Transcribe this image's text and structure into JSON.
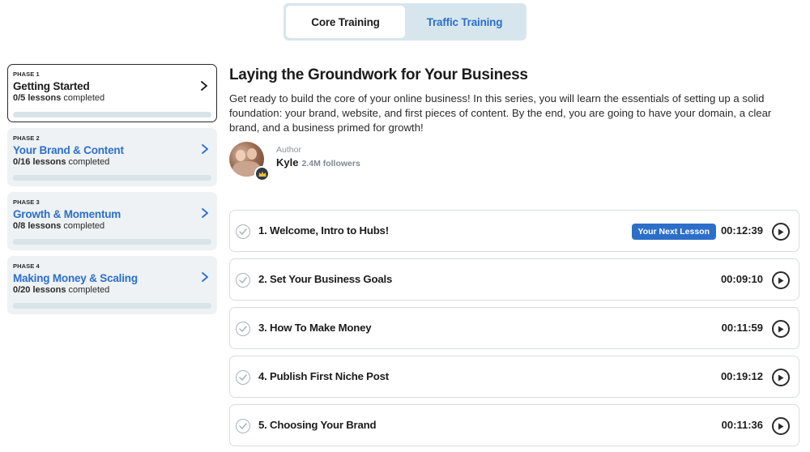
{
  "tabs": [
    {
      "label": "Core Training",
      "active": true
    },
    {
      "label": "Traffic Training",
      "active": false
    }
  ],
  "phases": [
    {
      "label": "PHASE 1",
      "title": "Getting Started",
      "lessons_count": "0/5 lessons",
      "completed_text": "completed",
      "progress": 0
    },
    {
      "label": "PHASE 2",
      "title": "Your Brand & Content",
      "lessons_count": "0/16 lessons",
      "completed_text": "completed",
      "progress": 0
    },
    {
      "label": "PHASE 3",
      "title": "Growth & Momentum",
      "lessons_count": "0/8 lessons",
      "completed_text": "completed",
      "progress": 0
    },
    {
      "label": "PHASE 4",
      "title": "Making Money & Scaling",
      "lessons_count": "0/20 lessons",
      "completed_text": "completed",
      "progress": 0
    }
  ],
  "main": {
    "title": "Laying the Groundwork for Your Business",
    "description": "Get ready to build the core of your online business! In this series, you will learn the essentials of setting up a solid foundation: your brand, website, and first pieces of content. By the end, you are going to have your domain, a clear brand, and a business primed for growth!",
    "author": {
      "role": "Author",
      "name": "Kyle",
      "followers": "2.4M followers"
    }
  },
  "lessons": [
    {
      "title": "1. Welcome, Intro to Hubs!",
      "duration": "00:12:39",
      "badge": "Your Next Lesson"
    },
    {
      "title": "2. Set Your Business Goals",
      "duration": "00:09:10"
    },
    {
      "title": "3. How To Make Money",
      "duration": "00:11:59"
    },
    {
      "title": "4. Publish First Niche Post",
      "duration": "00:19:12"
    },
    {
      "title": "5. Choosing Your Brand",
      "duration": "00:11:36"
    }
  ],
  "colors": {
    "accent": "#2c6fc9",
    "toggle_bg": "#d6e6ec",
    "phase_bg": "#eef2f4"
  },
  "icons": {
    "chevron": "chevron-right-icon",
    "check": "check-circle-icon",
    "play": "play-circle-icon",
    "crown": "crown-icon"
  }
}
